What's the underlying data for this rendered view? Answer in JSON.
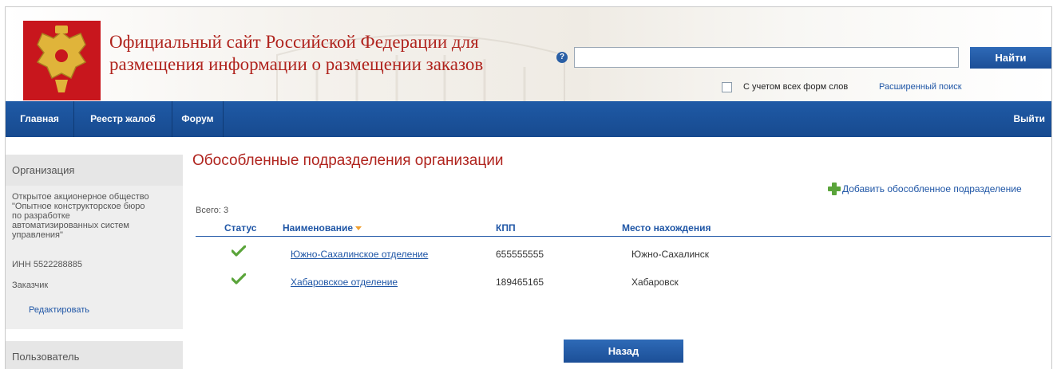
{
  "header": {
    "site_title": "Официальный сайт Российской Федерации для размещения информации о размещении заказов",
    "help_icon": "question-icon",
    "search": {
      "value": "",
      "placeholder": "",
      "button_label": "Найти"
    },
    "morphology_label": "С учетом всех форм слов",
    "morphology_checked": false,
    "advanced_search_label": "Расширенный поиск"
  },
  "nav": {
    "items": [
      {
        "label": "Главная"
      },
      {
        "label": "Реестр жалоб"
      },
      {
        "label": "Форум"
      }
    ],
    "logout_label": "Выйти"
  },
  "sidebar": {
    "org_header": "Организация",
    "org_name": "Открытое акционерное общество\n\"Опытное конструкторское бюро\nпо разработке\nавтоматизированных систем\nуправления\"",
    "inn": "ИНН 5522288885",
    "role": "Заказчик",
    "edit_label": "Редактировать",
    "user_header": "Пользователь"
  },
  "main": {
    "title": "Обособленные подразделения организации",
    "add_label": "Добавить обособленное подразделение",
    "total_label": "Всего: 3",
    "columns": {
      "status": "Статус",
      "name": "Наименование",
      "kpp": "КПП",
      "location": "Место нахождения"
    },
    "rows": [
      {
        "status_icon": "checkmark-icon",
        "name": "Южно-Сахалинское отделение",
        "kpp": "655555555",
        "location": "Южно-Сахалинск"
      },
      {
        "status_icon": "checkmark-icon",
        "name": "Хабаровское отделение",
        "kpp": "189465165",
        "location": "Хабаровск"
      }
    ],
    "back_label": "Назад"
  },
  "colors": {
    "brand_blue": "#1f56a6",
    "title_red": "#b0241e",
    "success_green": "#5aa43a"
  }
}
